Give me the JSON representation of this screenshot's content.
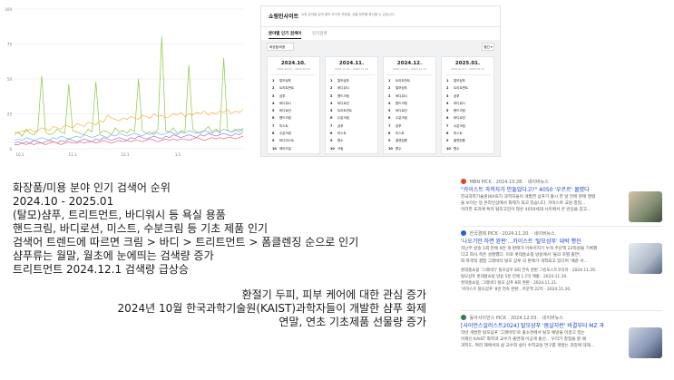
{
  "chart_data": {
    "type": "line",
    "title": "",
    "xlabel": "",
    "ylabel": "",
    "x_ticks": [
      "10.1",
      "11.1",
      "12.1",
      "1.1"
    ],
    "y_ticks": [
      0,
      25,
      50,
      75,
      100
    ],
    "ylim": [
      0,
      100
    ],
    "grid": true,
    "legend": "none",
    "series": [
      {
        "color": "#8ec641",
        "values": [
          10,
          12,
          9,
          14,
          11,
          10,
          13,
          52,
          12,
          10,
          11,
          14,
          12,
          11,
          46,
          13,
          12,
          11,
          10,
          14,
          12,
          48,
          11,
          13,
          12,
          10,
          15,
          12,
          13,
          11,
          14,
          12,
          50,
          13,
          11,
          12,
          10,
          14,
          80,
          13,
          12,
          15,
          11,
          13,
          12,
          60,
          14,
          12,
          11,
          13,
          16,
          12,
          14,
          11,
          65,
          13,
          12,
          14,
          12,
          15
        ]
      },
      {
        "color": "#f2b23e",
        "values": [
          12,
          11,
          13,
          12,
          14,
          12,
          13,
          15,
          14,
          13,
          16,
          15,
          14,
          17,
          16,
          15,
          18,
          17,
          16,
          19,
          18,
          17,
          20,
          19,
          24,
          22,
          21,
          20,
          22,
          21,
          23,
          22,
          21,
          24,
          23,
          22,
          25,
          23,
          24,
          22,
          23,
          25,
          24,
          26,
          23,
          25,
          24,
          26,
          25,
          27,
          24,
          26,
          25,
          27,
          26,
          28,
          25,
          27,
          26,
          28
        ]
      },
      {
        "color": "#6db3e8",
        "values": [
          6,
          7,
          6,
          8,
          7,
          6,
          7,
          8,
          7,
          6,
          8,
          7,
          9,
          8,
          7,
          8,
          9,
          8,
          10,
          9,
          8,
          9,
          10,
          9,
          8,
          10,
          9,
          11,
          10,
          9,
          10,
          11,
          10,
          9,
          11,
          10,
          12,
          11,
          10,
          11,
          12,
          11,
          10,
          12,
          11,
          13,
          12,
          11,
          12,
          13,
          12,
          11,
          13,
          12,
          14,
          13,
          12,
          13,
          14,
          13
        ]
      },
      {
        "color": "#9c6cd4",
        "values": [
          4,
          5,
          4,
          5,
          4,
          6,
          5,
          4,
          5,
          6,
          5,
          4,
          6,
          5,
          7,
          6,
          5,
          6,
          7,
          6,
          5,
          7,
          6,
          8,
          7,
          6,
          7,
          8,
          7,
          6,
          8,
          7,
          9,
          8,
          7,
          8,
          9,
          8,
          7,
          9,
          8,
          10,
          9,
          8,
          9,
          10,
          9,
          8,
          10,
          9,
          11,
          10,
          9,
          10,
          11,
          10,
          9,
          11,
          10,
          12
        ]
      },
      {
        "color": "#e35d6a",
        "values": [
          3,
          3,
          4,
          3,
          4,
          3,
          4,
          4,
          3,
          4,
          5,
          4,
          3,
          4,
          5,
          4,
          4,
          5,
          4,
          5,
          5,
          4,
          5,
          6,
          5,
          4,
          5,
          6,
          5,
          6,
          5,
          6,
          6,
          5,
          6,
          7,
          6,
          5,
          6,
          7,
          6,
          7,
          6,
          7,
          7,
          6,
          7,
          8,
          7,
          6,
          7,
          8,
          7,
          8,
          7,
          8,
          8,
          7,
          8,
          9
        ]
      }
    ]
  },
  "shopping_insight": {
    "title": "쇼핑인사이트",
    "description": "쇼핑 분야별 검색 클릭 추이와 연령별, 성별 정보를 확인할 수 있습니다.",
    "tab_active": "분야별 인기 검색어",
    "tab_inactive": "인기검색",
    "select_label": "화장품/미용",
    "more_label": "월간 ▾",
    "columns": [
      {
        "month": "2024.10.",
        "range": "2024.10.01 - 2024.10.31",
        "keywords": [
          "탈모샴푸",
          "트리트먼트",
          "샴푸",
          "바디워시",
          "바디로션",
          "핸드크림",
          "미스트",
          "수분크림",
          "바디미스트",
          "헤어오일"
        ]
      },
      {
        "month": "2024.11.",
        "range": "2024.11.01 - 2024.11.30",
        "keywords": [
          "탈모샴푸",
          "바디워시",
          "핸드크림",
          "바디로션",
          "트리트먼트",
          "수분크림",
          "샴푸",
          "미스트",
          "향수",
          "크림"
        ]
      },
      {
        "month": "2024.12.",
        "range": "2024.12.01 - 2024.12.31",
        "keywords": [
          "트리트먼트",
          "탈모샴푸",
          "바디워시",
          "핸드크림",
          "바디로션",
          "수분크림",
          "샴푸",
          "미스트",
          "클렌징폼",
          "향수"
        ]
      },
      {
        "month": "2025.01.",
        "range": "2025.01.01 - 2025.01.31",
        "keywords": [
          "탈모샴푸",
          "트리트먼트",
          "샴푸",
          "바디워시",
          "핸드크림",
          "바디로션",
          "수분크림",
          "미스트",
          "클렌징폼",
          "향수"
        ]
      }
    ]
  },
  "summary": {
    "lines": [
      "화장품/미용 분야 인기 검색어 순위",
      "2024.10 - 2025.01",
      "(탈모)샴푸, 트리트먼트, 바디워시 등 욕실 용품",
      "핸드크림, 바디로션, 미스트, 수분크림 등 기초 제품 인기",
      "검색어 트렌드에 따르면 크림 > 바디 > 트리트먼트 > 폼클렌징 순으로 인기",
      "샴푸류는 월말, 월초에 눈에띄는 검색량 증가",
      "트리트먼트 2024.12.1 검색량 급상승"
    ],
    "right_lines": [
      "환절기 두피, 피부 케어에 대한 관심 증가",
      "2024년 10월 한국과학기술원(KAIST)과학자들이 개발한 샴푸 화제",
      "연말, 연초 기초제품 선물량 증가"
    ]
  },
  "news": [
    {
      "source": "MBN",
      "meta": "PICK · 2024.10.28. · 네이버뉴스",
      "title": "\"카이스트 과학자가 만들었다고?\" 4050 '우르르' 몰렸다",
      "body": [
        "한국과학기술원(KAIST) 과학자들이 개발한 샴푸가 출시 한 달 만에 판매 행렬",
        "을 보이는 등 온라인상에서 화제가 되고 있습니다. 카이스트 교원 창업...",
        "이러한 효과에 특히 탈모고민이 많은 4050세대 사이에서 큰 반응을 얻고..."
      ],
      "related": []
    },
    {
      "source": "한국경제",
      "meta": "PICK · 2024.11.20. · 네이버뉴스",
      "title": "'나오기만 하면 완판'…카이스트 '탈모샴푸' 대박 행진",
      "body": [
        "지난주 방송 1회 만에 9만 개 판매가 이루어지기 누적 주문액 22억원을 기록했",
        "다고 회사 측은 설명했다. 이로 롯데홈쇼핑 방송에서 '물의 차별 출연',",
        "화 파격적 결합 그래비티 탈모 샴푸 의 판매가 개척되고 있다며 '예준 서..."
      ],
      "related": [
        "롯데홈쇼핑 '그래비티' 탈모샴푸 8회 연속 완판  그린포스트코리아 · 2024.11.20.",
        "탈모샴푸 롯데홈쇼핑 방송 5분 만에 1.1억 매출 · 2024.11.20.",
        "롯데홈쇼핑, 그래비티 탈모 샴푸 8회 완판 · 2024.11.21.",
        "'카이스트 탈모샴푸' 8번 연속 완판…주문액 22억 · 2024.11.20."
      ]
    },
    {
      "source": "동아사이언스",
      "meta": "PICK · 2024.12.03. · 네이버뉴스",
      "title": "[사이언스일러스트2024] 탈모샴푸 '몸살자란' 비결부터 MZ 과",
      "body": [
        "작년 개발한 탈모샴푸 '그래비티'로 출소천에서 탈모 예방을 이끌고 있는",
        "이재인 KAIST 화학과 교수가 출연해 이공계 출신... 우리가 창업을 할 때",
        "과학도, 여러 해에서의 삶 교수와 삶이 수학교실 연구를 개발는 과정에 대해..."
      ],
      "related": []
    }
  ],
  "colors": {
    "grid": "#e6e6e6",
    "accent_blue": "#1b3fc4",
    "link_blue": "#1b3fc4"
  }
}
